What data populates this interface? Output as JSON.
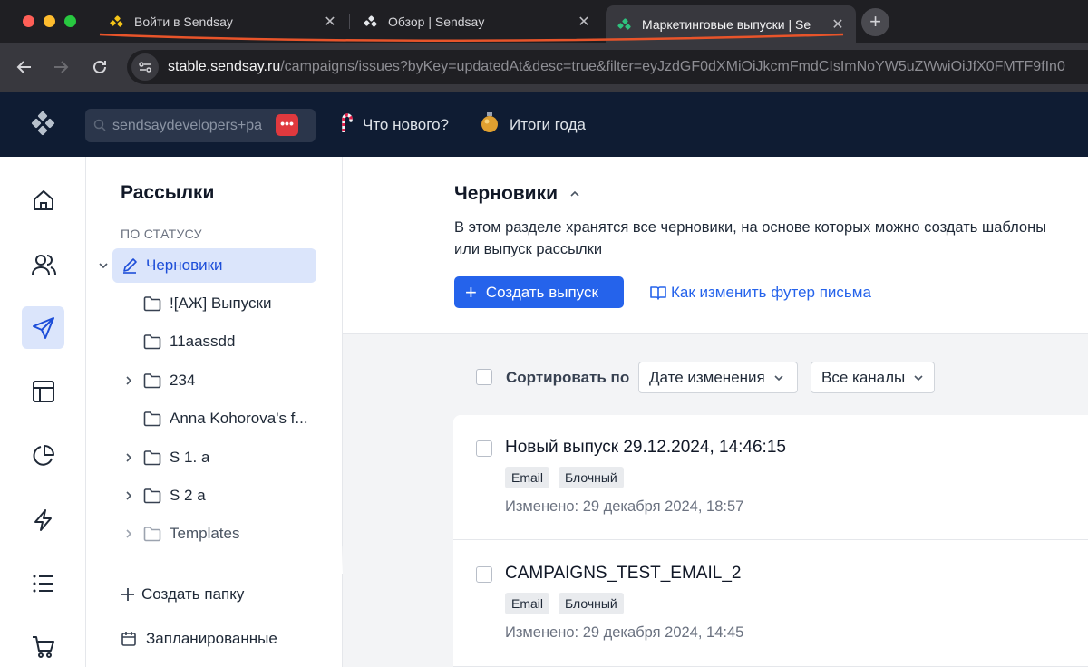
{
  "browser": {
    "tabs": [
      {
        "title": "Войти в Sendsay"
      },
      {
        "title": "Обзор | Sendsay"
      },
      {
        "title": "Маркетинговые выпуски | Se"
      }
    ],
    "url_host": "stable.sendsay.ru",
    "url_path": "/campaigns/issues?byKey=updatedAt&desc=true&filter=eyJzdGF0dXMiOiJkcmFmdCIsImNoYW5uZWwiOiJfX0FMTF9fIn0"
  },
  "header": {
    "search_value": "sendsaydevelopers+pa",
    "search_badge": "•••",
    "whats_new": "Что нового?",
    "year_results": "Итоги года"
  },
  "sidebar": {
    "icons": [
      "home-icon",
      "users-icon",
      "send-icon",
      "layout-icon",
      "pie-chart-icon",
      "lightning-icon",
      "list-icon",
      "cart-icon"
    ]
  },
  "folders": {
    "title": "Рассылки",
    "section": "ПО СТАТУСУ",
    "active": "Черновики",
    "items": [
      {
        "label": "![АЖ] Выпуски"
      },
      {
        "label": "11aassdd"
      },
      {
        "label": "234"
      },
      {
        "label": "Anna Kohorova's f..."
      },
      {
        "label": "S 1. a"
      },
      {
        "label": "S 2 a"
      },
      {
        "label": "Templates"
      }
    ],
    "create_folder": "Создать папку",
    "scheduled": "Запланированные"
  },
  "main": {
    "title": "Черновики",
    "description": "В этом разделе хранятся все черновики, на основе которых можно создать шаблоны или выпуск рассылки",
    "create_button": "Создать выпуск",
    "help_link": "Как изменить футер письма",
    "sort_label": "Сортировать по",
    "sort_value": "Дате изменения",
    "channel_value": "Все каналы",
    "issues": [
      {
        "title": "Новый выпуск 29.12.2024, 14:46:15",
        "tags": [
          "Email",
          "Блочный"
        ],
        "modified": "Изменено: 29 декабря 2024, 18:57"
      },
      {
        "title": "CAMPAIGNS_TEST_EMAIL_2",
        "tags": [
          "Email",
          "Блочный"
        ],
        "modified": "Изменено: 29 декабря 2024, 14:45"
      }
    ]
  },
  "colors": {
    "accent": "#2563eb",
    "header_bg": "#0f1c33",
    "annotation": "#e8542a"
  }
}
